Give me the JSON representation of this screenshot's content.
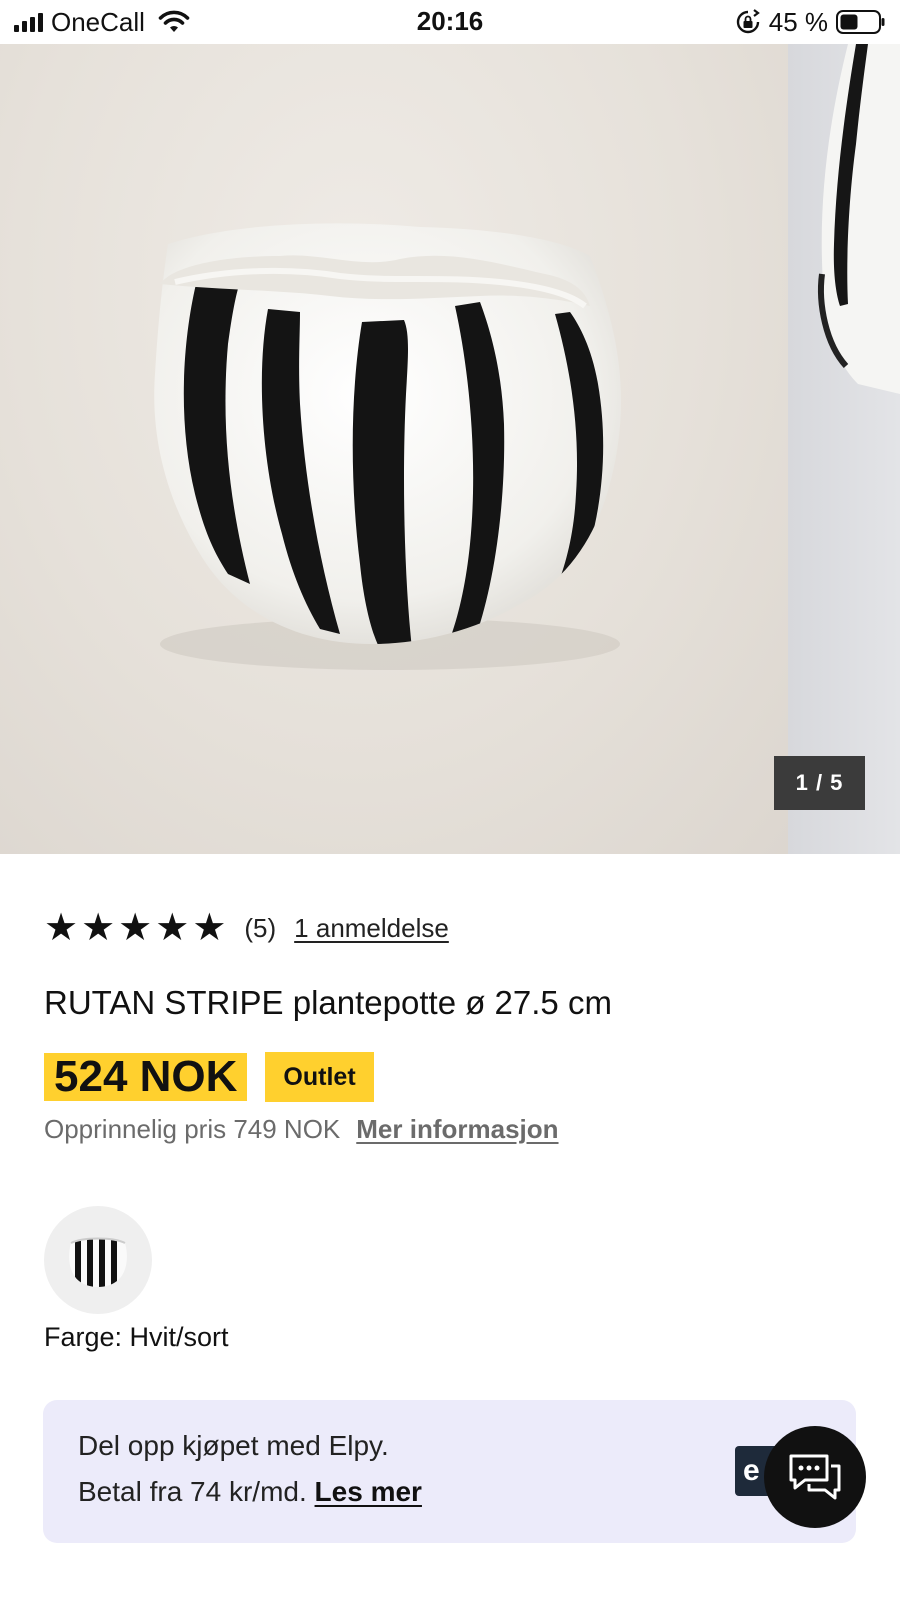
{
  "status_bar": {
    "carrier": "OneCall",
    "time": "20:16",
    "battery_percent": "45 %",
    "icons": [
      "signal-icon",
      "wifi-icon",
      "rotation-lock-icon",
      "battery-icon"
    ]
  },
  "gallery": {
    "counter": "1 / 5",
    "current_image": 1,
    "total_images": 5
  },
  "rating": {
    "stars": 5,
    "star_icon": "star-icon",
    "count": "(5)",
    "reviews_link": "1 anmeldelse"
  },
  "product": {
    "title": "RUTAN STRIPE plantepotte ø 27.5 cm",
    "price": "524 NOK",
    "badge": "Outlet",
    "original_price": "Opprinnelig pris 749 NOK",
    "more_info_link": "Mer informasjon",
    "color_label": "Farge: Hvit/sort"
  },
  "elpy": {
    "line1": "Del opp kjøpet med Elpy.",
    "line2_prefix": "Betal fra 74 kr/md.",
    "read_more_link": "Les mer",
    "logo_letter": "e"
  },
  "chat": {
    "icon": "chat-icon"
  },
  "colors": {
    "price_highlight": "#ffd02e",
    "elpy_background": "#ecebfa",
    "counter_background": "#3b3b3b",
    "chat_button": "#111111"
  }
}
